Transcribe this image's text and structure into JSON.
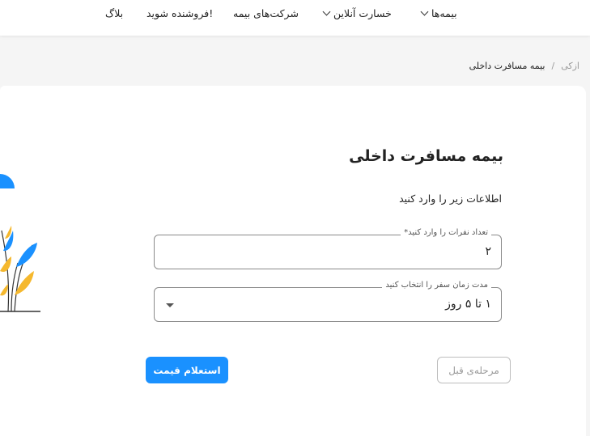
{
  "nav": {
    "items": [
      {
        "label": "بیمه‌ها",
        "has_chevron": true
      },
      {
        "label": "خسارت آنلاین",
        "has_chevron": true
      },
      {
        "label": "شرکت‌های بیمه",
        "has_chevron": false
      },
      {
        "label": "فروشنده شوید!",
        "has_chevron": false
      },
      {
        "label": "بلاگ",
        "has_chevron": false
      }
    ]
  },
  "breadcrumb": {
    "home": "ازکی",
    "separator": "/",
    "current": "بیمه مسافرت داخلی"
  },
  "form": {
    "title": "بیمه مسافرت داخلی",
    "subtitle": "اطلاعات زیر را وارد کنید",
    "travelers": {
      "label": "تعداد نفرات را وارد کنید*",
      "value": "۲"
    },
    "duration": {
      "label": "مدت زمان سفر را انتخاب کنید",
      "value": "۱ تا ۵ روز"
    }
  },
  "buttons": {
    "previous": "مرحله‌ی قبل",
    "get_quote": "استعلام قیمت"
  },
  "colors": {
    "primary": "#1a91ff",
    "illustration_blue": "#1a91ff",
    "illustration_yellow": "#f5b82e"
  }
}
